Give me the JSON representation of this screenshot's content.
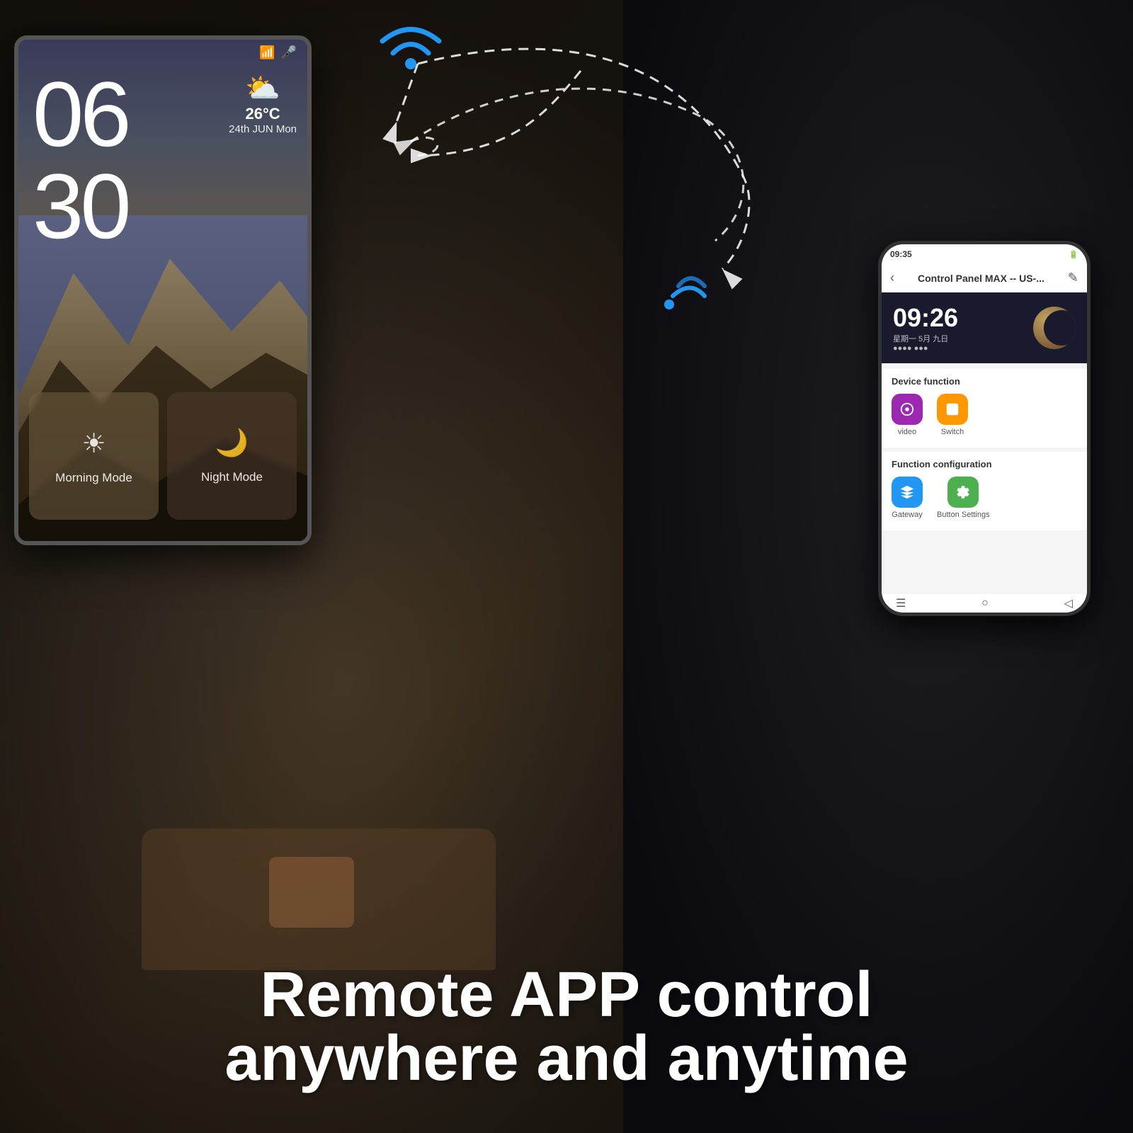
{
  "scene": {
    "background_color": "#1a1a1a"
  },
  "tablet": {
    "hour": "06",
    "minute": "30",
    "weather": {
      "icon": "⛅",
      "temp": "26°C",
      "date": "24th JUN  Mon"
    },
    "tiles": [
      {
        "label": "Morning Mode",
        "icon": "☀",
        "type": "morning"
      },
      {
        "label": "Night Mode",
        "icon": "🌙",
        "type": "night"
      }
    ]
  },
  "phone": {
    "status_bar": {
      "time": "09:35",
      "icons": "🔋"
    },
    "header": {
      "title": "Control Panel MAX -- US-...",
      "back_icon": "‹",
      "edit_icon": "✎"
    },
    "clock_widget": {
      "time": "09:26",
      "date_line1": "星期一 5月 九日",
      "date_line2": "●●●● ●●●"
    },
    "device_function": {
      "title": "Device function",
      "items": [
        {
          "label": "video",
          "icon": "📷",
          "color": "icon-purple"
        },
        {
          "label": "Switch",
          "icon": "⚡",
          "color": "icon-orange"
        }
      ]
    },
    "function_config": {
      "title": "Function configuration",
      "items": [
        {
          "label": "Gateway",
          "icon": "🏠",
          "color": "icon-blue"
        },
        {
          "label": "Button Settings",
          "icon": "⚙",
          "color": "icon-green"
        }
      ]
    },
    "nav": {
      "menu": "☰",
      "home": "○",
      "back": "◁"
    }
  },
  "bottom_text": {
    "line1": "Remote APP control",
    "line2": "anywhere and anytime"
  }
}
